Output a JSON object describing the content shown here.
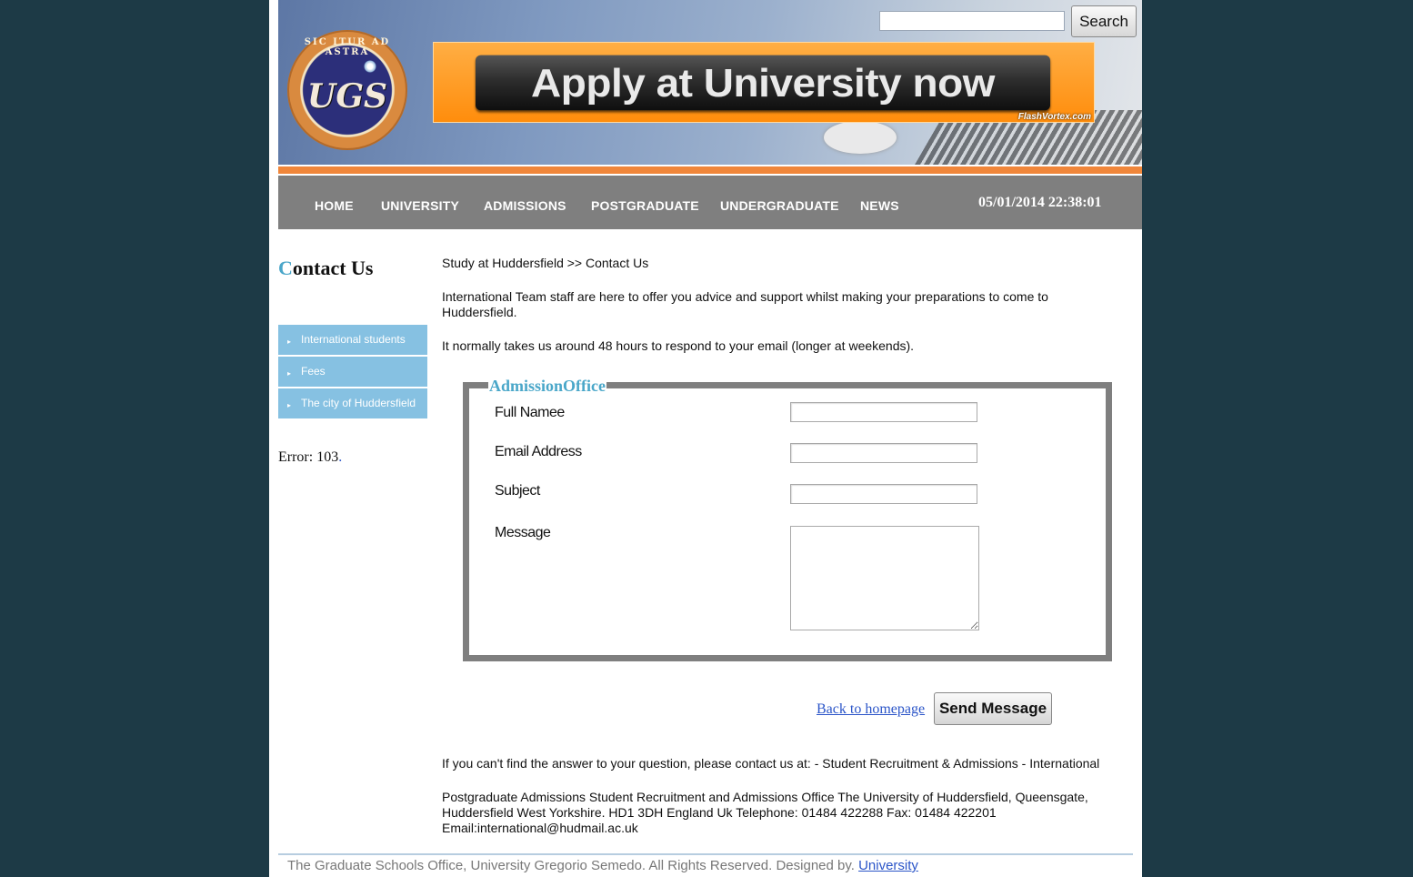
{
  "header": {
    "logo": {
      "motto": "SIC ITUR AD ASTRA",
      "monogram": "UGS"
    },
    "search": {
      "placeholder": "",
      "button_label": "Search"
    },
    "banner": {
      "text": "Apply at University now",
      "credit": "FlashVortex.com"
    }
  },
  "nav": {
    "items": [
      {
        "label": "HOME"
      },
      {
        "label": "UNIVERSITY"
      },
      {
        "label": "ADMISSIONS"
      },
      {
        "label": "POSTGRADUATE"
      },
      {
        "label": "UNDERGRADUATE"
      },
      {
        "label": "NEWS"
      }
    ],
    "datetime": "05/01/2014 22:38:01"
  },
  "sidebar": {
    "title_first": "C",
    "title_rest": "ontact Us",
    "items": [
      {
        "label": "International students"
      },
      {
        "label": "Fees"
      },
      {
        "label": "The city of Huddersfield"
      }
    ],
    "error_text": "Error: 103",
    "error_link": "."
  },
  "main": {
    "breadcrumb": "Study at Huddersfield >> Contact Us",
    "intro": "International Team staff are here to offer you advice and support whilst making your preparations to come to Huddersfield.",
    "response_time": "It normally takes us around 48 hours to respond to your email (longer at weekends).",
    "form": {
      "legend": "AdmissionOffice",
      "full_name_label": "Full Namee",
      "email_label": "Email Address",
      "subject_label": "Subject",
      "message_label": "Message",
      "full_name_value": "",
      "email_value": "",
      "subject_value": "",
      "message_value": ""
    },
    "back_link": "Back to homepage",
    "send_button": "Send Message",
    "contact_line": "If you can't find the answer to your question, please contact us at: - Student Recruitment & Admissions - International",
    "address_line1": "Postgraduate Admissions Student Recruitment and Admissions Office The University of Huddersfield, Queensgate,",
    "address_line2": "Huddersfield West Yorkshire. HD1 3DH England Uk Telephone: 01484 422288 Fax: 01484 422201",
    "email_line": "Email:international@hudmail.ac.uk"
  },
  "footer": {
    "text": "The Graduate Schools Office, University Gregorio Semedo. All Rights Reserved. Designed by. ",
    "link": "University"
  },
  "colors": {
    "background": "#1d3a46",
    "nav": "#7f7f7f",
    "accent_blue": "#4ba6c9",
    "sidebar_item": "#86c1e2",
    "orange": "#f0863a"
  }
}
